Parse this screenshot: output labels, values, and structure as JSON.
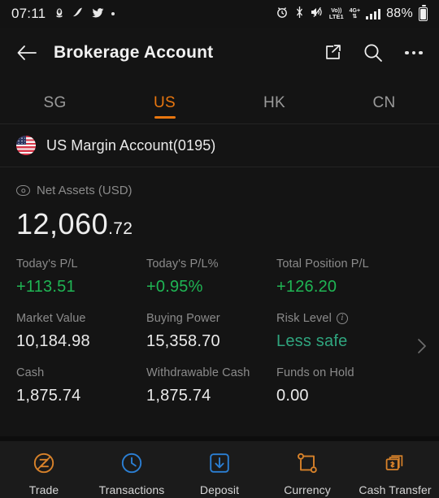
{
  "statusbar": {
    "time": "07:11",
    "left_icons": [
      "penguin-icon",
      "music-icon",
      "twitter-icon",
      "dot-icon"
    ],
    "right_icons": [
      "alarm-icon",
      "bluetooth-icon",
      "mute-icon",
      "volte-icon",
      "network-4g-plus-icon",
      "signal-bars-icon"
    ],
    "volte_label_top": "Vo))",
    "volte_label_bottom": "LTE1",
    "network_label": "4G+",
    "battery": "88%"
  },
  "header": {
    "back_icon": "back-arrow-icon",
    "title": "Brokerage Account",
    "share_icon": "share-icon",
    "search_icon": "search-icon",
    "more_icon": "more-dots-icon"
  },
  "tabs": [
    {
      "label": "SG",
      "active": false
    },
    {
      "label": "US",
      "active": true
    },
    {
      "label": "HK",
      "active": false
    },
    {
      "label": "CN",
      "active": false
    }
  ],
  "account": {
    "flag_icon": "us-flag-icon",
    "name": "US Margin Account(0195)"
  },
  "net_assets": {
    "eye_icon": "eye-visible-icon",
    "label": "Net Assets (USD)",
    "integer": "12,060",
    "decimal": ".72"
  },
  "stats": [
    [
      {
        "label": "Today's P/L",
        "value": "+113.51",
        "color": "green"
      },
      {
        "label": "Today's P/L%",
        "value": "+0.95%",
        "color": "green"
      },
      {
        "label": "Total Position P/L",
        "value": "+126.20",
        "color": "green"
      }
    ],
    [
      {
        "label": "Market Value",
        "value": "10,184.98",
        "color": "plain"
      },
      {
        "label": "Buying Power",
        "value": "15,358.70",
        "color": "plain"
      },
      {
        "label": "Risk Level",
        "value": "Less safe",
        "color": "teal",
        "info_icon": "info-icon"
      }
    ],
    [
      {
        "label": "Cash",
        "value": "1,875.74",
        "color": "plain"
      },
      {
        "label": "Withdrawable Cash",
        "value": "1,875.74",
        "color": "plain"
      },
      {
        "label": "Funds on Hold",
        "value": "0.00",
        "color": "plain"
      }
    ]
  ],
  "detail_chevron_icon": "chevron-right-icon",
  "bottombar": [
    {
      "label": "Trade",
      "icon": "trade-circle-icon",
      "color": "#d8822a"
    },
    {
      "label": "Transactions",
      "icon": "clock-icon",
      "color": "#2b7fd4"
    },
    {
      "label": "Deposit",
      "icon": "deposit-down-arrow-icon",
      "color": "#2b7fd4"
    },
    {
      "label": "Currency",
      "icon": "currency-exchange-icon",
      "color": "#d8822a"
    },
    {
      "label": "Cash Transfer",
      "icon": "cash-transfer-icon",
      "color": "#d8822a"
    }
  ],
  "colors": {
    "accent_orange": "#e8760f",
    "green": "#1fb554",
    "teal": "#2fa57e",
    "background": "#141414",
    "bottombar_bg": "#1b1b1b"
  }
}
